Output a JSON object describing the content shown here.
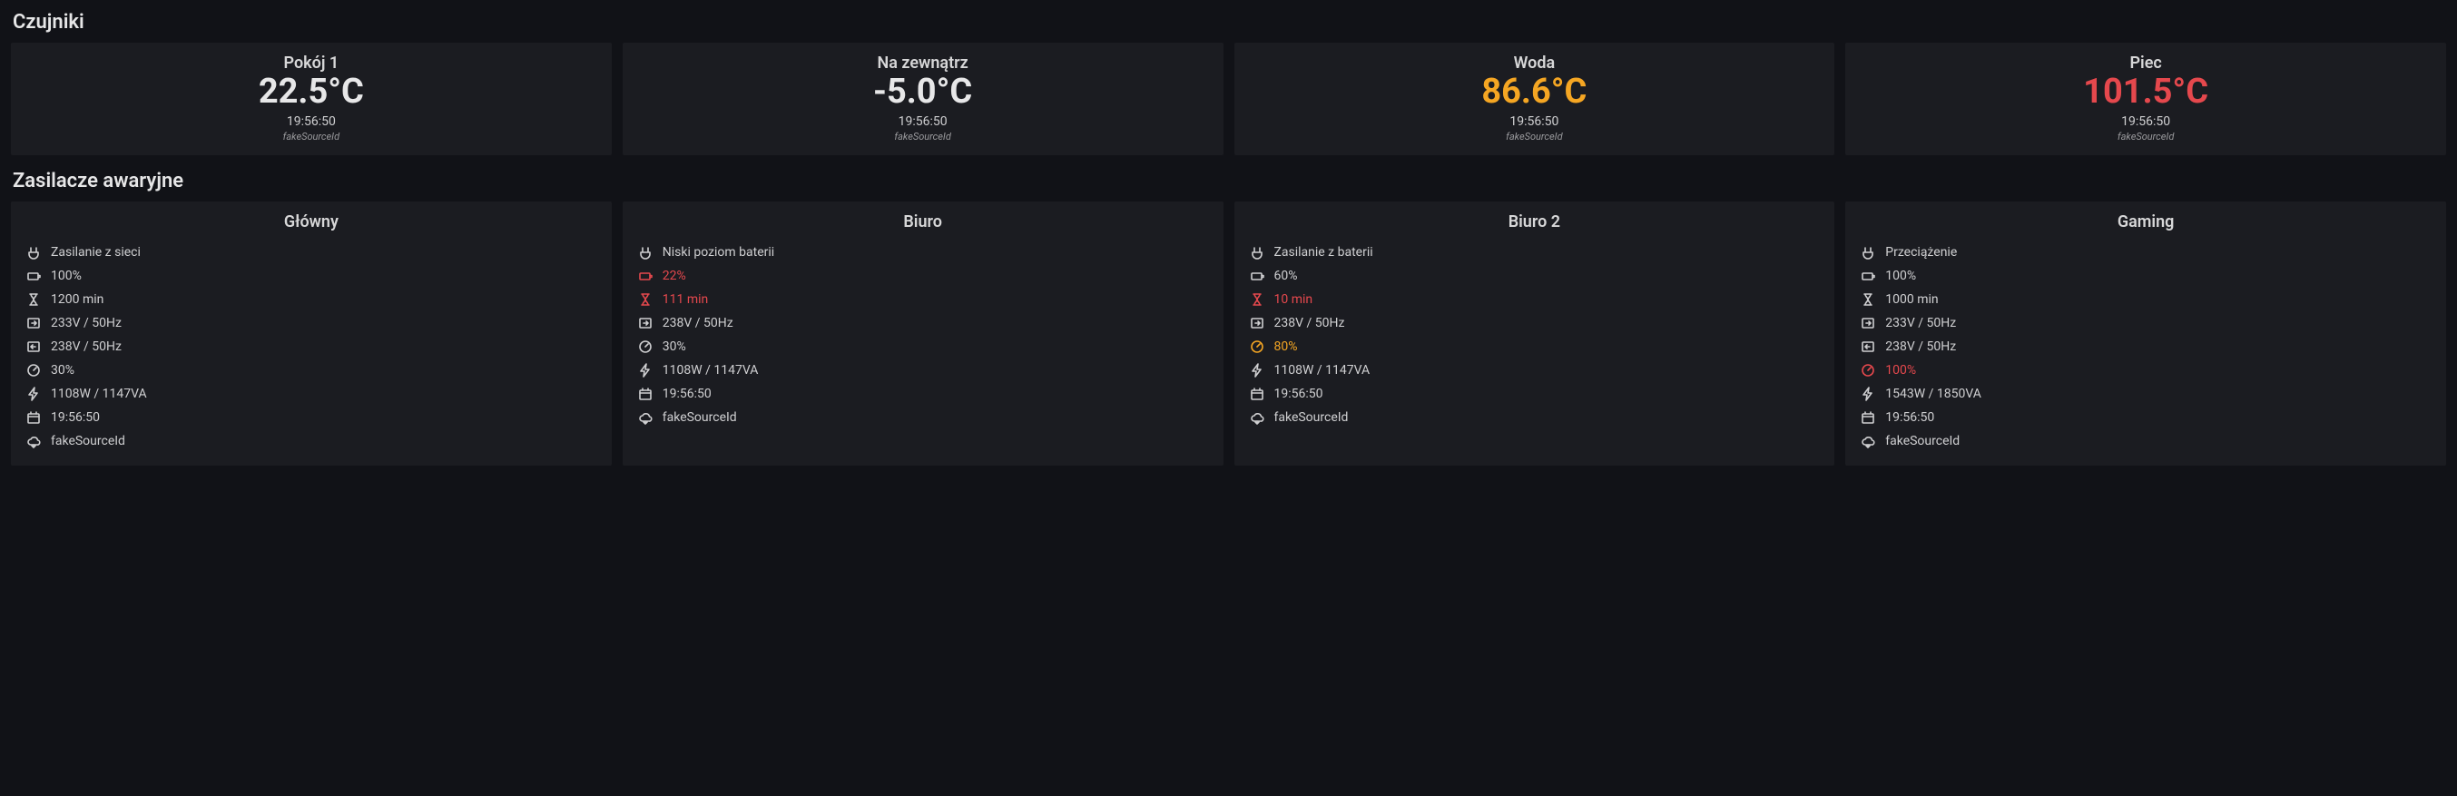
{
  "sections": {
    "sensors_title": "Czujniki",
    "ups_title": "Zasilacze awaryjne"
  },
  "sensors": [
    {
      "label": "Pokój 1",
      "value": "22.5°C",
      "state": "normal",
      "time": "19:56:50",
      "source": "fakeSourceId"
    },
    {
      "label": "Na zewnątrz",
      "value": "-5.0°C",
      "state": "normal",
      "time": "19:56:50",
      "source": "fakeSourceId"
    },
    {
      "label": "Woda",
      "value": "86.6°C",
      "state": "warn",
      "time": "19:56:50",
      "source": "fakeSourceId"
    },
    {
      "label": "Piec",
      "value": "101.5°C",
      "state": "crit",
      "time": "19:56:50",
      "source": "fakeSourceId"
    }
  ],
  "ups": [
    {
      "title": "Główny",
      "rows": [
        {
          "icon": "plug",
          "text": "Zasilanie z sieci",
          "state": "normal"
        },
        {
          "icon": "battery",
          "text": "100%",
          "state": "normal"
        },
        {
          "icon": "hourglass",
          "text": "1200 min",
          "state": "normal"
        },
        {
          "icon": "in",
          "text": "233V / 50Hz",
          "state": "normal"
        },
        {
          "icon": "out",
          "text": "238V / 50Hz",
          "state": "normal"
        },
        {
          "icon": "gauge",
          "text": "30%",
          "state": "normal"
        },
        {
          "icon": "bolt",
          "text": "1108W / 1147VA",
          "state": "normal"
        },
        {
          "icon": "clock",
          "text": "19:56:50",
          "state": "normal"
        },
        {
          "icon": "cloud",
          "text": "fakeSourceId",
          "state": "normal"
        }
      ]
    },
    {
      "title": "Biuro",
      "rows": [
        {
          "icon": "plug",
          "text": "Niski poziom baterii",
          "state": "normal"
        },
        {
          "icon": "battery",
          "text": "22%",
          "state": "crit"
        },
        {
          "icon": "hourglass",
          "text": "111 min",
          "state": "crit"
        },
        {
          "icon": "in",
          "text": "238V / 50Hz",
          "state": "normal"
        },
        {
          "icon": "gauge",
          "text": "30%",
          "state": "normal"
        },
        {
          "icon": "bolt",
          "text": "1108W / 1147VA",
          "state": "normal"
        },
        {
          "icon": "clock",
          "text": "19:56:50",
          "state": "normal"
        },
        {
          "icon": "cloud",
          "text": "fakeSourceId",
          "state": "normal"
        }
      ]
    },
    {
      "title": "Biuro 2",
      "rows": [
        {
          "icon": "plug",
          "text": "Zasilanie z baterii",
          "state": "normal"
        },
        {
          "icon": "battery",
          "text": "60%",
          "state": "normal"
        },
        {
          "icon": "hourglass",
          "text": "10 min",
          "state": "crit"
        },
        {
          "icon": "in",
          "text": "238V / 50Hz",
          "state": "normal"
        },
        {
          "icon": "gauge",
          "text": "80%",
          "state": "warn"
        },
        {
          "icon": "bolt",
          "text": "1108W / 1147VA",
          "state": "normal"
        },
        {
          "icon": "clock",
          "text": "19:56:50",
          "state": "normal"
        },
        {
          "icon": "cloud",
          "text": "fakeSourceId",
          "state": "normal"
        }
      ]
    },
    {
      "title": "Gaming",
      "rows": [
        {
          "icon": "plug",
          "text": "Przeciążenie",
          "state": "normal"
        },
        {
          "icon": "battery",
          "text": "100%",
          "state": "normal"
        },
        {
          "icon": "hourglass",
          "text": "1000 min",
          "state": "normal"
        },
        {
          "icon": "in",
          "text": "233V / 50Hz",
          "state": "normal"
        },
        {
          "icon": "out",
          "text": "238V / 50Hz",
          "state": "normal"
        },
        {
          "icon": "gauge",
          "text": "100%",
          "state": "crit"
        },
        {
          "icon": "bolt",
          "text": "1543W / 1850VA",
          "state": "normal"
        },
        {
          "icon": "clock",
          "text": "19:56:50",
          "state": "normal"
        },
        {
          "icon": "cloud",
          "text": "fakeSourceId",
          "state": "normal"
        }
      ]
    }
  ]
}
